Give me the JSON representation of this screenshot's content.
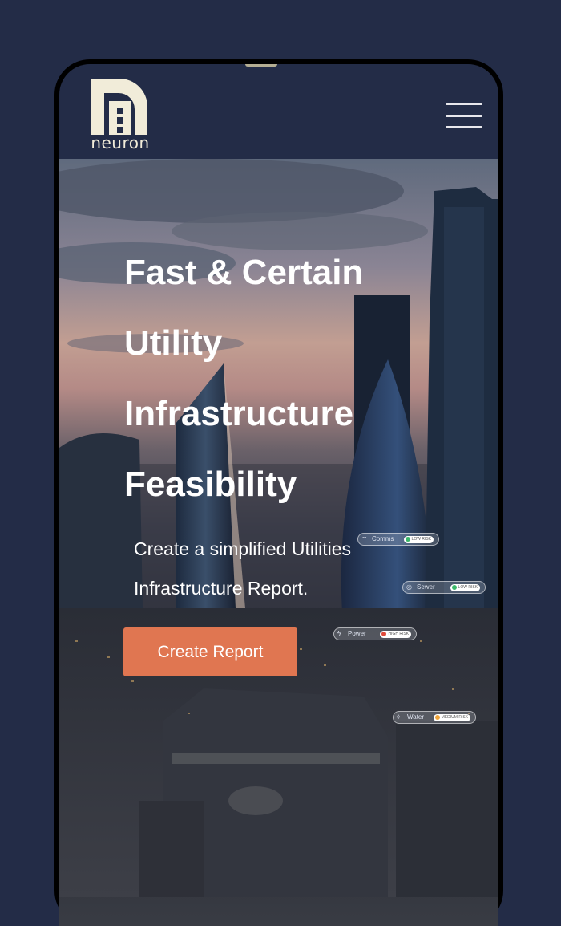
{
  "brand": {
    "name": "neuron"
  },
  "header": {
    "menu_icon": "hamburger-menu-icon"
  },
  "hero": {
    "headline_lines": [
      "Fast & Certain",
      "Utility",
      "Infrastructure",
      "Feasibility"
    ],
    "subline_lines": [
      "Create a simplified Utilities",
      "Infrastructure Report."
    ],
    "cta_label": "Create Report"
  },
  "overlay_tags": [
    {
      "label": "Comms",
      "icon": "antenna-icon",
      "status": "LOW RISK",
      "status_color": "#3bb86a"
    },
    {
      "label": "Sewer",
      "icon": "sewer-icon",
      "status": "LOW RISK",
      "status_color": "#3bb86a"
    },
    {
      "label": "Power",
      "icon": "lightning-icon",
      "status": "HIGH RISK",
      "status_color": "#e04a3a"
    },
    {
      "label": "Water",
      "icon": "droplet-icon",
      "status": "MEDIUM RISK",
      "status_color": "#f0a53a"
    }
  ],
  "colors": {
    "background": "#232c47",
    "accent": "#e07651",
    "logo": "#f1ecd9"
  }
}
